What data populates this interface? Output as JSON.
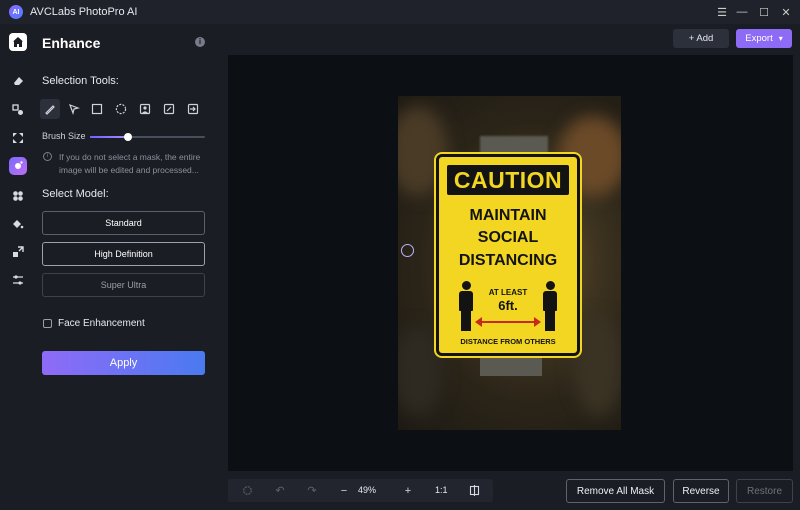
{
  "app": {
    "title": "AVCLabs PhotoPro AI",
    "logo": "AI"
  },
  "window": {
    "minimize": "☰",
    "min": "—",
    "max": "☐",
    "close": "✕"
  },
  "panel": {
    "title": "Enhance",
    "info_icon": "i",
    "selection_tools_label": "Selection Tools:",
    "brush_size_label": "Brush Size",
    "brush_size_value": 0.33,
    "note": "If you do not select a mask, the entire image will be edited and processed...",
    "select_model_label": "Select Model:",
    "models": [
      {
        "label": "Standard",
        "state": "normal"
      },
      {
        "label": "High Definition",
        "state": "active"
      },
      {
        "label": "Super Ultra",
        "state": "dim"
      }
    ],
    "face_enhancement_label": "Face Enhancement",
    "face_enhancement_checked": false,
    "apply_label": "Apply"
  },
  "toolbar": {
    "add_label": "+ Add",
    "export_label": "Export"
  },
  "sign": {
    "header": "CAUTION",
    "line1": "MAINTAIN",
    "line2": "SOCIAL",
    "line3": "DISTANCING",
    "at_least": "AT LEAST",
    "distance": "6ft.",
    "footer": "DISTANCE FROM OTHERS"
  },
  "bottom": {
    "zoom": "49%",
    "ratio": "1:1"
  },
  "actions": {
    "remove_all_mask": "Remove All Mask",
    "reverse": "Reverse",
    "restore": "Restore"
  },
  "colors": {
    "accent": "#8d6bf5",
    "sign_yellow": "#f2d621"
  }
}
